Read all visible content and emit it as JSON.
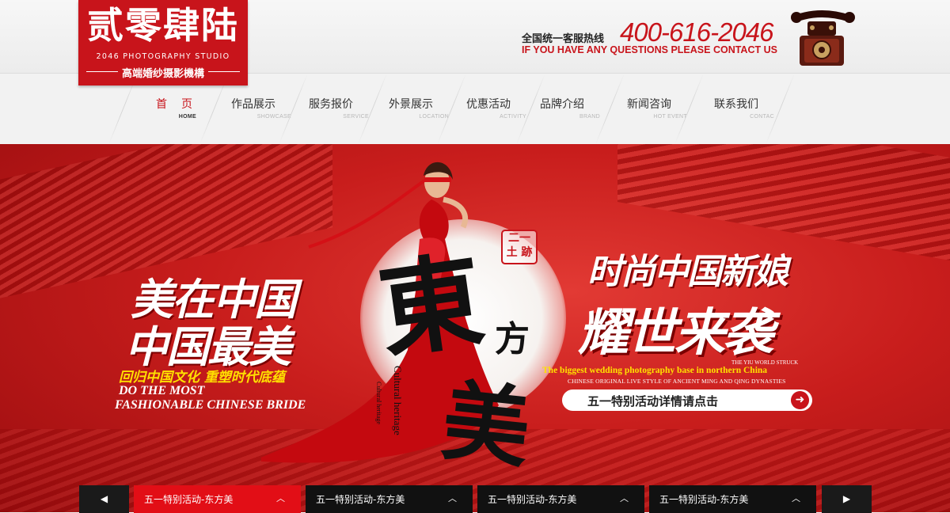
{
  "logo": {
    "name_cn": "贰零肆陆",
    "name_en": "2046 PHOTOGRAPHY STUDIO",
    "tagline": "高端婚纱摄影機構"
  },
  "hotline": {
    "label": "全国统一客服热线",
    "number": "400-616-2046",
    "english": "IF YOU HAVE ANY QUESTIONS PLEASE CONTACT US"
  },
  "nav": {
    "items": [
      {
        "cn": "首页",
        "en": "HOME"
      },
      {
        "cn": "作品展示",
        "en": "SHOWCASE"
      },
      {
        "cn": "服务报价",
        "en": "SERVICE"
      },
      {
        "cn": "外景展示",
        "en": "LOCATION"
      },
      {
        "cn": "优惠活动",
        "en": "ACTIVITY"
      },
      {
        "cn": "品牌介绍",
        "en": "BRAND"
      },
      {
        "cn": "新闻咨询",
        "en": "HOT EVENT"
      },
      {
        "cn": "联系我们",
        "en": "CONTAC"
      }
    ]
  },
  "banner": {
    "left_line1": "美在中国",
    "left_line2": "中国最美",
    "left_slogan": "回归中国文化  重塑时代底蕴",
    "left_en1": "DO THE MOST",
    "left_en2": "FASHIONABLE CHINESE BRIDE",
    "center_char1": "東",
    "center_char2": "方",
    "center_char3": "美",
    "seal_text": "二一 土 跡",
    "vertical_text": "Cultural heritage",
    "vertical_small": "Cultural heritage",
    "right_line1": "时尚中国新娘",
    "right_line2": "耀世来袭",
    "right_en_small": "THE YIU WORLD STRUCK",
    "right_en_yellow": "The biggest wedding photography base in northern China",
    "right_en_desc": "CHINESE ORIGINAL LIVE STYLE OF ANCIENT MING AND QING DYNASTIES",
    "cta_label": "五一特别活动详情请点击",
    "cta_arrow": "➜"
  },
  "slider": {
    "prev_icon": "◀",
    "next_icon": "▶",
    "tabs": [
      {
        "label": "五一特别活动-东方美",
        "active": true
      },
      {
        "label": "五一特别活动-东方美",
        "active": false
      },
      {
        "label": "五一特别活动-东方美",
        "active": false
      },
      {
        "label": "五一特别活动-东方美",
        "active": false
      }
    ],
    "caret": "︿"
  },
  "colors": {
    "brand_red": "#c8141b",
    "tab_active": "#e20e16",
    "tab_bg": "#111111"
  }
}
